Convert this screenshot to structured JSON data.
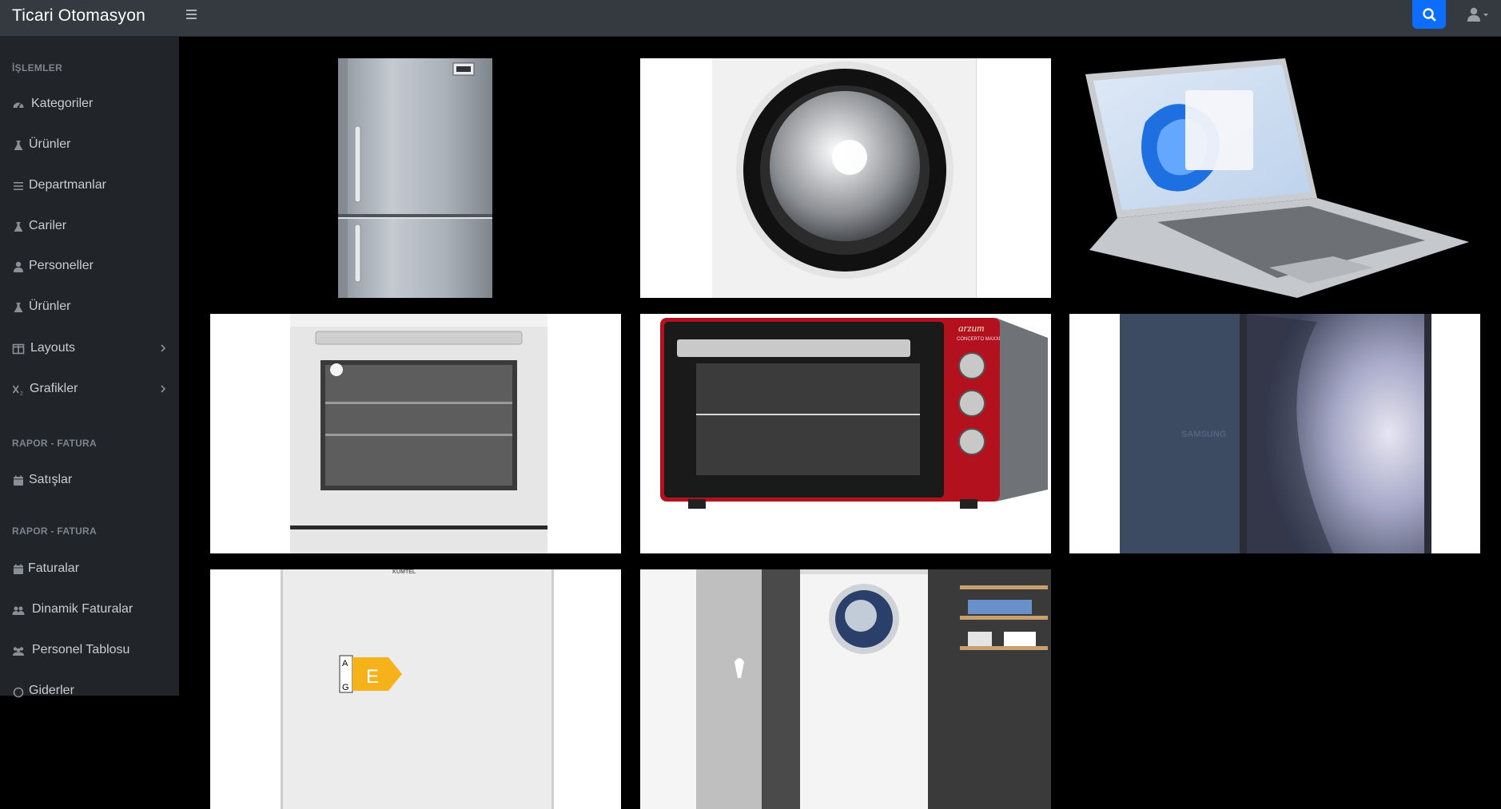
{
  "header": {
    "brand": "Ticari Otomasyon"
  },
  "sidebar": {
    "section_islemler": "İŞLEMLER",
    "items": [
      {
        "label": "Kategoriler"
      },
      {
        "label": "Ürünler"
      },
      {
        "label": "Departmanlar"
      },
      {
        "label": "Cariler"
      },
      {
        "label": "Personeller"
      },
      {
        "label": "Ürünler"
      },
      {
        "label": "Layouts"
      },
      {
        "label": "Grafikler"
      }
    ],
    "section_rapor_1": "RAPOR - FATURA",
    "items2": [
      {
        "label": "Satışlar"
      }
    ],
    "section_rapor_2": "RAPOR - FATURA",
    "items3": [
      {
        "label": "Faturalar"
      },
      {
        "label": "Dinamik Faturalar"
      },
      {
        "label": "Personel Tablosu"
      },
      {
        "label": "Giderler"
      }
    ]
  },
  "products": {
    "oven_brand": "arzum",
    "oven_model": "CONCERTO MAXXI",
    "tablet_brand": "SAMSUNG",
    "fridge_brand": "KUMTEL",
    "energy_scale_top": "A",
    "energy_scale_bottom": "G",
    "energy_class": "E"
  },
  "colors": {
    "topbar": "#343a40",
    "sidebar": "#212529",
    "search_button": "#0d6efd",
    "content_bg": "#000000"
  }
}
